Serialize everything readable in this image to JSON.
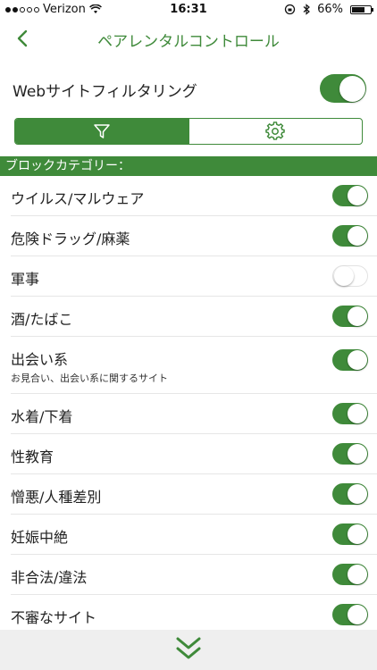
{
  "status_bar": {
    "carrier": "Verizon",
    "time": "16:31",
    "battery": "66%"
  },
  "nav": {
    "title": "ペアレンタルコントロール"
  },
  "web_filtering": {
    "label": "Webサイトフィルタリング",
    "enabled": true
  },
  "segments": [
    {
      "icon": "filter-icon",
      "active": true
    },
    {
      "icon": "gear-icon",
      "active": false
    }
  ],
  "section": {
    "title": "ブロックカテゴリー："
  },
  "categories": [
    {
      "label": "ウイルス/マルウェア",
      "enabled": true
    },
    {
      "label": "危険ドラッグ/麻薬",
      "enabled": true
    },
    {
      "label": "軍事",
      "enabled": false
    },
    {
      "label": "酒/たばこ",
      "enabled": true
    },
    {
      "label": "出会い系",
      "sub": "お見合い、出会い系に関するサイト",
      "enabled": true
    },
    {
      "label": "水着/下着",
      "enabled": true
    },
    {
      "label": "性教育",
      "enabled": true
    },
    {
      "label": "憎悪/人種差別",
      "enabled": true
    },
    {
      "label": "妊娠中絶",
      "enabled": true
    },
    {
      "label": "非合法/違法",
      "enabled": true
    },
    {
      "label": "不審なサイト",
      "enabled": true
    }
  ],
  "colors": {
    "accent": "#3f8a3a",
    "bottom_bar": "#efefef"
  }
}
